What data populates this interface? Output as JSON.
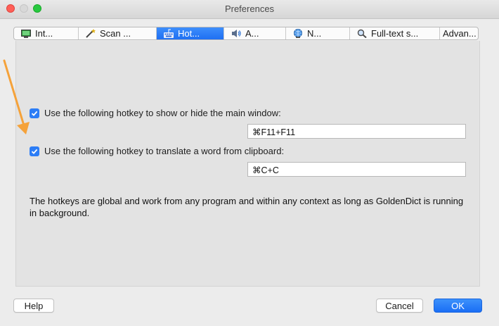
{
  "window": {
    "title": "Preferences",
    "traffic_lights": [
      "close",
      "minimize",
      "zoom"
    ]
  },
  "tabs": [
    {
      "label": "Int...",
      "icon": "interface-icon",
      "active": false
    },
    {
      "label": "Scan ...",
      "icon": "magic-wand-icon",
      "active": false
    },
    {
      "label": "Hot...",
      "icon": "keyboard-icon",
      "active": true
    },
    {
      "label": "A...",
      "icon": "speaker-icon",
      "active": false
    },
    {
      "label": "N...",
      "icon": "network-icon",
      "active": false
    },
    {
      "label": "Full-text s...",
      "icon": "magnifier-icon",
      "active": false
    },
    {
      "label": "Advan...",
      "icon": "",
      "active": false
    }
  ],
  "hotkeys": {
    "main_window": {
      "checked": true,
      "label": "Use the following hotkey to show or hide the main window:",
      "value": "⌘F11+F11"
    },
    "clipboard": {
      "checked": true,
      "label": "Use the following hotkey to translate a word from clipboard:",
      "value": "⌘C+C"
    },
    "note": "The hotkeys are global and work from any program and within any context as long as GoldenDict is running in background."
  },
  "buttons": {
    "help": "Help",
    "cancel": "Cancel",
    "ok": "OK"
  },
  "colors": {
    "accent": "#1f6ff2",
    "annotation_arrow": "#f5a23a"
  }
}
